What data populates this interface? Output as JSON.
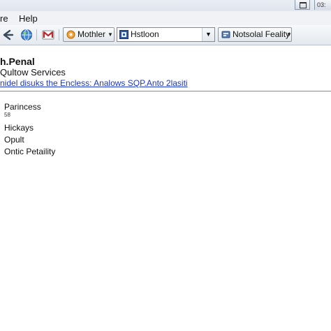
{
  "titlebar": {
    "badge_text": "03:",
    "restore_icon": "restore-icon"
  },
  "menubar": {
    "items": [
      {
        "label": "re"
      },
      {
        "label": "Help"
      }
    ]
  },
  "toolbar": {
    "back_icon": "back-arrow-icon",
    "globe_icon": "globe-icon",
    "mail_icon": "mail-icon",
    "dropdown1": {
      "label": "Mothler",
      "icon": "orange-circle-icon"
    },
    "combo": {
      "value": "Hstloon",
      "icon": "app-icon"
    },
    "dropdown2": {
      "label": "Notsolal Feality",
      "icon": "tool-icon"
    }
  },
  "content": {
    "heading": "h.Penal",
    "subheading": "Qultow Services",
    "link": "nidel disuks the Encless: Analows SQP.Anto 2lasiti",
    "items": [
      {
        "label": "Parincess",
        "sub": "58"
      },
      {
        "label": "Hickays"
      },
      {
        "label": "Opult"
      },
      {
        "label": "Ontic Petaility"
      }
    ]
  },
  "colors": {
    "link": "#1a36c8",
    "toolbar_bg": "#e4e9ef",
    "divider": "#8a8a8a"
  }
}
